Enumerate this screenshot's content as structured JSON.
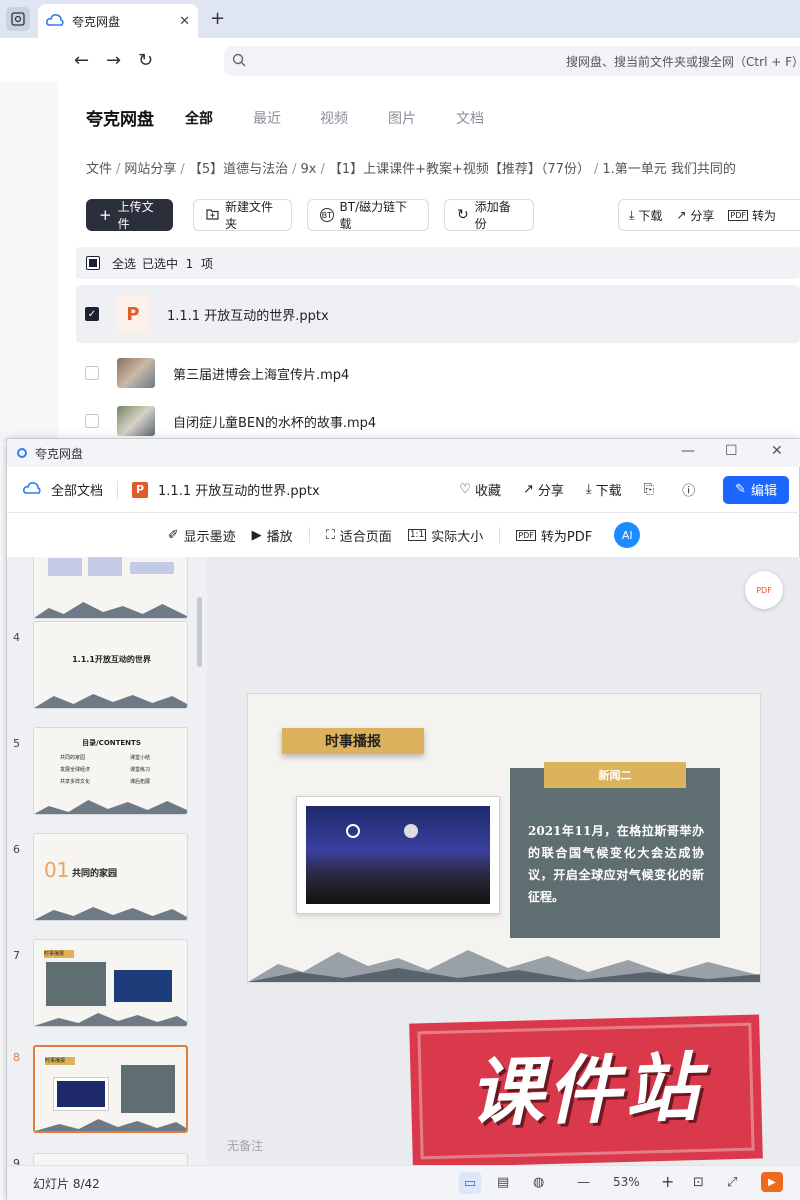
{
  "browser": {
    "tab_title": "夸克网盘",
    "address_placeholder": "搜网盘、搜当前文件夹或搜全网（Ctrl + F）"
  },
  "drive": {
    "brand": "夸克网盘",
    "nav_tabs": [
      "全部",
      "最近",
      "视频",
      "图片",
      "文档"
    ],
    "breadcrumb": [
      "文件",
      "网站分享",
      "【5】道德与法治",
      "9x",
      "【1】上课课件+教案+视频【推荐】（77份）",
      "1.第一单元 我们共同的"
    ],
    "actions": {
      "upload": "上传文件",
      "new_folder": "新建文件夹",
      "bt": "BT/磁力链下载",
      "backup": "添加备份",
      "download": "下载",
      "share": "分享",
      "convert": "转为"
    },
    "select_bar": {
      "select_all": "全选",
      "selected": "已选中",
      "count": "1",
      "unit": "项"
    },
    "files": [
      {
        "name": "1.1.1 开放互动的世界.pptx",
        "selected": true
      },
      {
        "name": "第三届进博会上海宣传片.mp4",
        "selected": false
      },
      {
        "name": "自闭症儿童BEN的水杯的故事.mp4",
        "selected": false
      }
    ]
  },
  "preview": {
    "window_title": "夸克网盘",
    "all_docs": "全部文档",
    "file_name": "1.1.1 开放互动的世界.pptx",
    "top_actions": {
      "collect": "收藏",
      "share": "分享",
      "download": "下载",
      "edit": "编辑"
    },
    "tools": [
      "显示墨迹",
      "播放",
      "适合页面",
      "实际大小",
      "转为PDF"
    ],
    "thumbs": [
      {
        "num": "",
        "title": ""
      },
      {
        "num": "4",
        "title": "1.1.1开放互动的世界"
      },
      {
        "num": "5",
        "title": "目录/CONTENTS",
        "items": [
          "共同的家园",
          "课堂小结",
          "发展全球经济",
          "课堂练习",
          "共享多样文化",
          "课后拓展"
        ]
      },
      {
        "num": "6",
        "title": "共同的家园",
        "big": "01"
      },
      {
        "num": "7",
        "title": "时事播报"
      },
      {
        "num": "8",
        "title": "时事播报"
      },
      {
        "num": "9",
        "title": ""
      }
    ],
    "slide": {
      "heading": "时事播报",
      "news_tag": "新闻二",
      "news_text": "2021年11月，在格拉斯哥举办的联合国气候变化大会达成协议，开启全球应对气候变化的新征程。"
    },
    "notes": "无备注",
    "status": {
      "slide_label": "幻灯片 8/42",
      "zoom": "53%"
    },
    "watermark": "课件站"
  },
  "colors": {
    "accent": "#1a66ff",
    "orange": "#e07b39",
    "gold": "#ddb25c",
    "slate": "#5f6e70"
  }
}
